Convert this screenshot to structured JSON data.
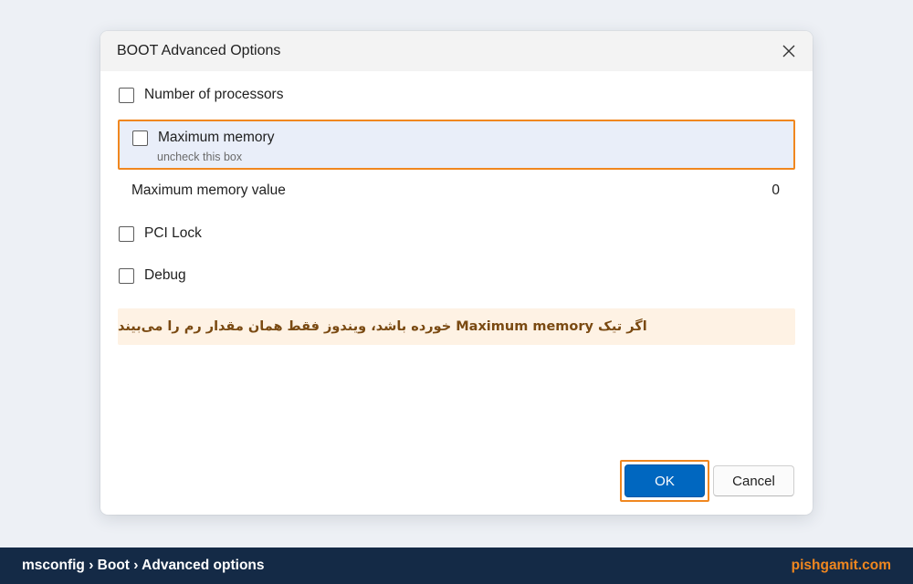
{
  "dialog": {
    "title": "BOOT Advanced Options",
    "close_icon": "close-icon"
  },
  "options": {
    "number_of_processors": {
      "label": "Number of processors",
      "checked": false
    },
    "maximum_memory": {
      "label": "Maximum memory",
      "hint": "uncheck this box",
      "checked": false
    },
    "maximum_memory_value": {
      "label": "Maximum memory value",
      "value": "0"
    },
    "pci_lock": {
      "label": "PCI Lock",
      "checked": false
    },
    "debug": {
      "label": "Debug",
      "checked": false
    }
  },
  "note": {
    "text": "اگر تیک Maximum memory خورده باشد، ویندوز فقط همان مقدار رم را می‌بیند"
  },
  "buttons": {
    "ok_label": "OK",
    "cancel_label": "Cancel"
  },
  "footer": {
    "breadcrumb": "msconfig › Boot › Advanced options",
    "brand": "pishgamit.com"
  },
  "colors": {
    "accent_highlight": "#f0871f",
    "primary_button": "#0067c0",
    "footer_bg": "#142a46"
  }
}
